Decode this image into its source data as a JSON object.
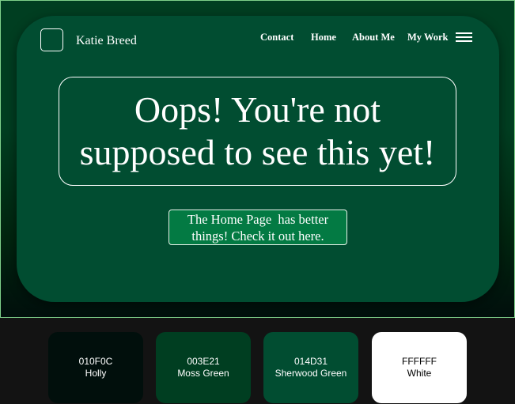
{
  "header": {
    "site_name": "Katie Breed",
    "nav": [
      "Contact",
      "Home",
      "About Me",
      "My Work"
    ]
  },
  "main": {
    "headline_line1": "Oops! You're not",
    "headline_line2": "supposed to see this yet!",
    "cta_line1": "The Home Page  has better",
    "cta_line2": "things! Check it out here."
  },
  "palette": [
    {
      "hex": "010F0C",
      "name": "Holly",
      "color": "#010F0C",
      "text_color": "#ffffff"
    },
    {
      "hex": "003E21",
      "name": "Moss Green",
      "color": "#003E21",
      "text_color": "#ffffff"
    },
    {
      "hex": "014D31",
      "name": "Sherwood Green",
      "color": "#014D31",
      "text_color": "#ffffff"
    },
    {
      "hex": "FFFFFF",
      "name": "White",
      "color": "#FFFFFF",
      "text_color": "#000000"
    }
  ],
  "icons": {
    "logo": "logo-square-icon",
    "menu": "hamburger-menu-icon"
  },
  "colors": {
    "page_background": "#131313",
    "stage_border": "#7fd08a",
    "card": "#014D31",
    "cta_button": "#037a43"
  }
}
